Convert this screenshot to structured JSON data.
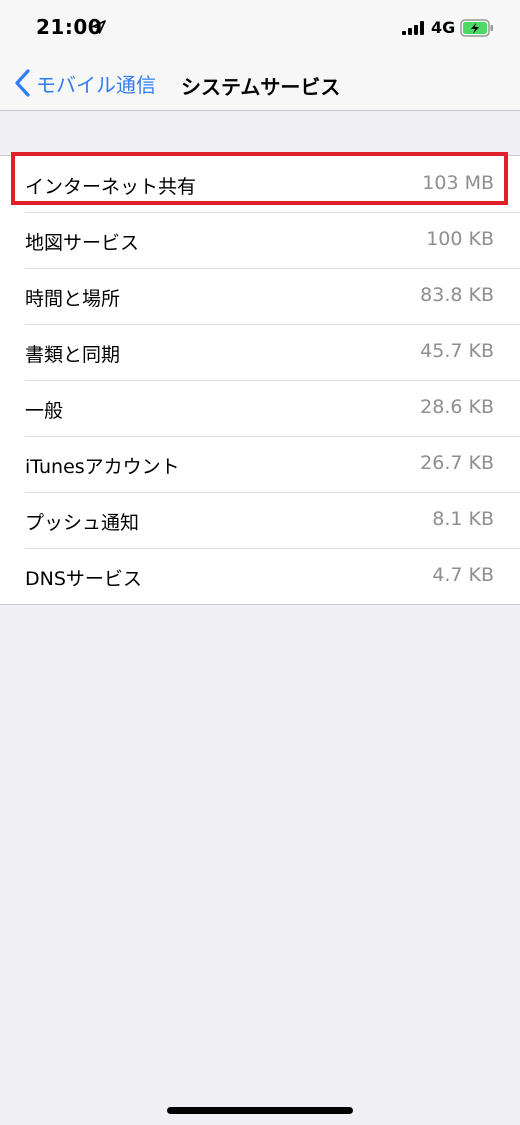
{
  "status_bar": {
    "time": "21:00",
    "network": "4G",
    "location_icon": "location-arrow-icon",
    "signal_icon": "cellular-signal-icon",
    "battery_icon": "battery-charging-icon",
    "battery_color": "#4cd964"
  },
  "nav": {
    "back_label": "モバイル通信",
    "title": "システムサービス",
    "accent_color": "#2f7df6"
  },
  "services": [
    {
      "label": "インターネット共有",
      "value": "103 MB"
    },
    {
      "label": "地図サービス",
      "value": "100 KB"
    },
    {
      "label": "時間と場所",
      "value": "83.8 KB"
    },
    {
      "label": "書類と同期",
      "value": "45.7 KB"
    },
    {
      "label": "一般",
      "value": "28.6 KB"
    },
    {
      "label": "iTunesアカウント",
      "value": "26.7 KB"
    },
    {
      "label": "プッシュ通知",
      "value": "8.1 KB"
    },
    {
      "label": "DNSサービス",
      "value": "4.7 KB"
    }
  ],
  "highlight_color": "#e0212a"
}
